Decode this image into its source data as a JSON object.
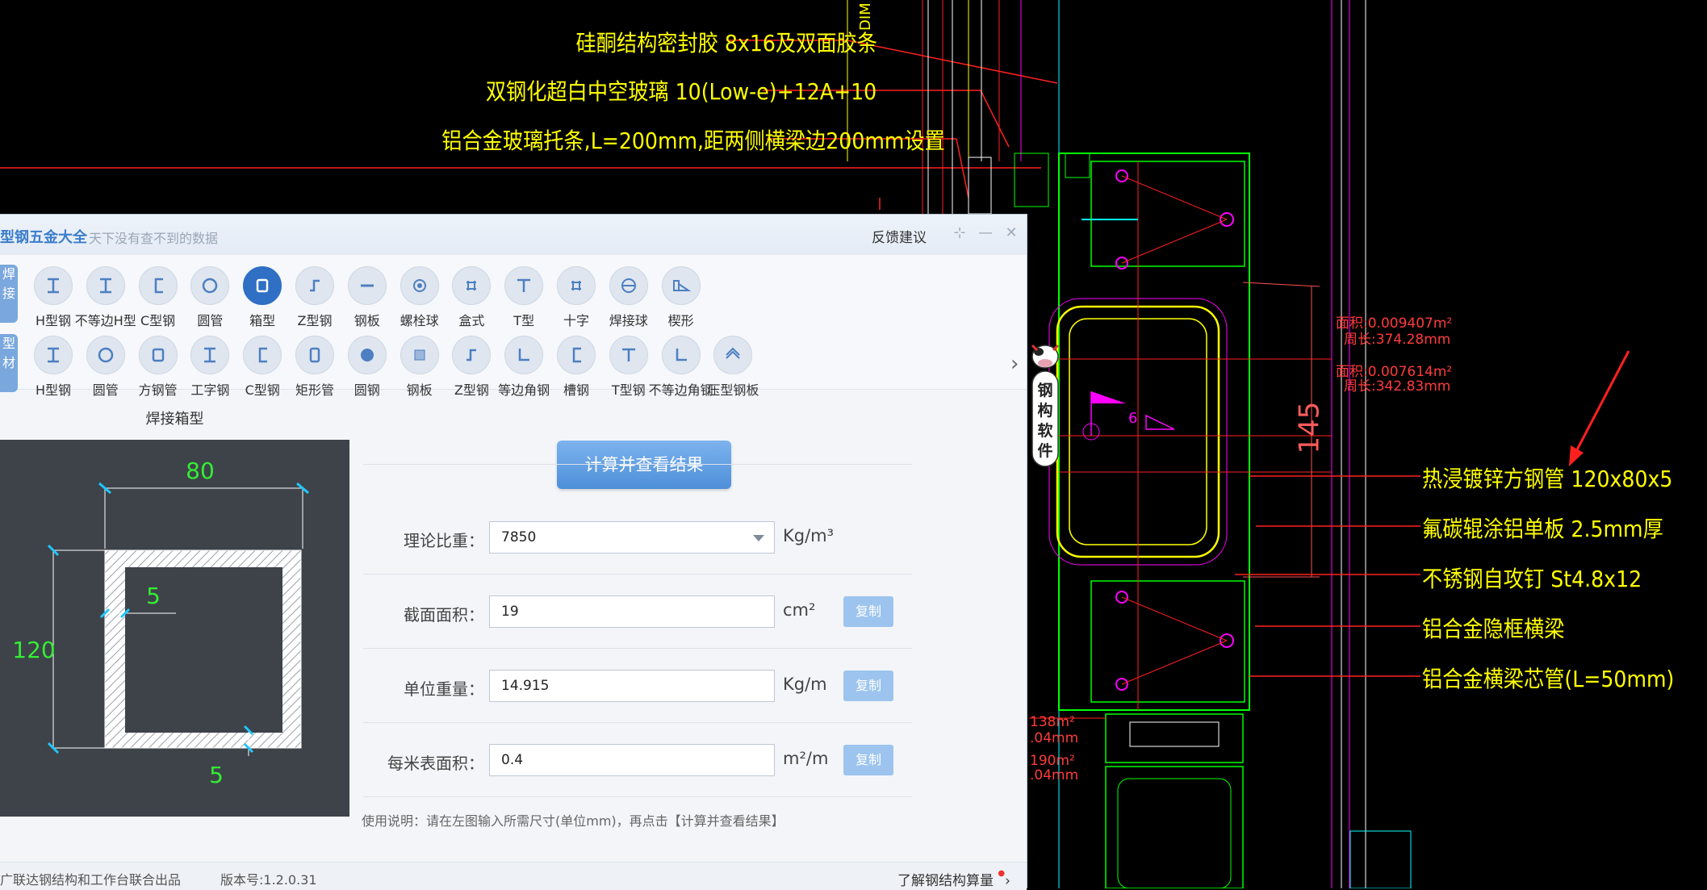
{
  "cad": {
    "notes_left": [
      "硅酮结构密封胶 8x16及双面胶条",
      "双钢化超白中空玻璃 10(Low-e)+12A+10",
      "铝合金玻璃托条,L=200mm,距两侧横梁边200mm设置"
    ],
    "notes_right": [
      "热浸镀锌方钢管 120x80x5",
      "氟碳辊涂铝单板 2.5mm厚",
      "不锈钢自攻钉 St4.8x12",
      "铝合金隐框横梁",
      "铝合金横梁芯管(L=50mm)"
    ],
    "area_labels": [
      "面积:0.009407m²",
      "周长:374.28mm",
      "面积:0.007614m²",
      "周长:342.83mm"
    ],
    "partial_labels": [
      "138m²",
      ".04mm",
      "190m²",
      ".04mm"
    ],
    "dim_label": "DIM",
    "dim_145": "145",
    "dim_6": "6"
  },
  "app": {
    "title": "型钢五金大全",
    "subtitle": "天下没有查不到的数据",
    "feedback": "反馈建议",
    "side_tabs": [
      "焊接",
      "型材"
    ],
    "row1": [
      "H型钢",
      "不等边H型",
      "C型钢",
      "圆管",
      "箱型",
      "Z型钢",
      "钢板",
      "螺栓球",
      "盒式",
      "T型",
      "十字",
      "焊接球",
      "楔形"
    ],
    "row2": [
      "H型钢",
      "圆管",
      "方钢管",
      "工字钢",
      "C型钢",
      "矩形管",
      "圆钢",
      "钢板",
      "Z型钢",
      "等边角钢",
      "槽钢",
      "T型钢",
      "不等边角钢",
      "压型钢板"
    ],
    "active_tool": "箱型",
    "panel_title": "焊接箱型",
    "diagram": {
      "width": "80",
      "height": "120",
      "web": "5",
      "flange": "5"
    },
    "calc_button": "计算并查看结果",
    "fields": [
      {
        "label": "理论比重：",
        "value": "7850",
        "unit": "Kg/m³"
      },
      {
        "label": "截面面积：",
        "value": "19",
        "unit": "cm²",
        "copy": "复制"
      },
      {
        "label": "单位重量：",
        "value": "14.915",
        "unit": "Kg/m",
        "copy": "复制"
      },
      {
        "label": "每米表面积：",
        "value": "0.4",
        "unit": "m²/m",
        "copy": "复制"
      }
    ],
    "usage": "使用说明：请在左图输入所需尺寸(单位mm)，再点击【计算并查看结果】",
    "status_left": "广联达钢结构和工作台联合出品",
    "status_version": "版本号:1.2.0.31",
    "status_right": "了解钢结构算量",
    "mascot_text": "钢构软件"
  },
  "colors": {
    "accent": "#2f6fc4",
    "cad_text": "#ffff00",
    "cad_red": "#ff3030",
    "cad_green": "#00ff00",
    "cad_magenta": "#ff00ff"
  }
}
